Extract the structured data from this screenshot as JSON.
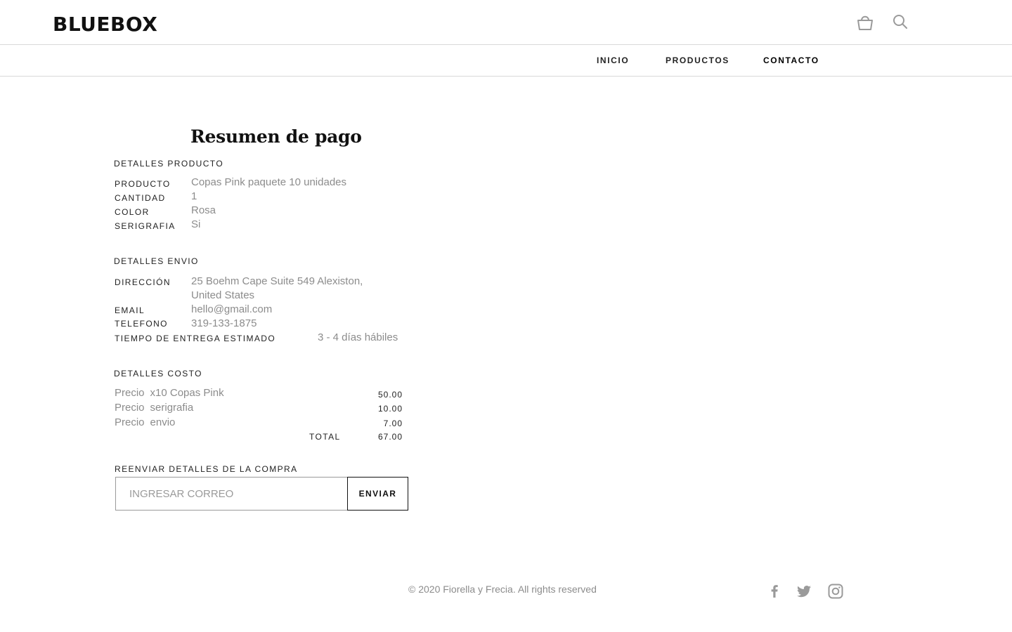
{
  "header": {
    "logo": "BLUEBOX",
    "icons": [
      "shopping-bag-icon",
      "search-icon"
    ]
  },
  "nav": {
    "items": [
      {
        "label": "INICIO"
      },
      {
        "label": "PRODUCTOS"
      },
      {
        "label": "CONTACTO",
        "active": true
      }
    ]
  },
  "summary": {
    "title": "Resumen de pago",
    "product_details": {
      "heading": "DETALLES PRODUCTO",
      "rows": [
        {
          "label": "PRODUCTO",
          "value": "Copas Pink paquete 10 unidades"
        },
        {
          "label": "CANTIDAD",
          "value": "1"
        },
        {
          "label": "COLOR",
          "value": "Rosa"
        },
        {
          "label": "SERIGRAFIA",
          "value": "Si"
        }
      ]
    },
    "shipping_details": {
      "heading": "DETALLES ENVIO",
      "address_label": "DIRECCIÓN",
      "address_line1": "25 Boehm Cape Suite 549  Alexiston,",
      "address_line2": "United States",
      "email_label": "EMAIL",
      "email_value": "hello@gmail.com",
      "phone_label": "TELEFONO",
      "phone_value": "319-133-1875",
      "delivery_label": "TIEMPO DE ENTREGA ESTIMADO",
      "delivery_value": "3 - 4 días hábiles"
    },
    "cost_details": {
      "heading": "DETALLES COSTO",
      "rows": [
        {
          "prefix": "Precio",
          "item": "x10 Copas Pink",
          "amount": "50.00"
        },
        {
          "prefix": "Precio",
          "item": "serigrafia",
          "amount": "10.00"
        },
        {
          "prefix": "Precio",
          "item": "envio",
          "amount": "7.00"
        }
      ],
      "total_label": "TOTAL",
      "total_amount": "67.00"
    },
    "resend": {
      "heading": "REENVIAR DETALLES DE LA COMPRA",
      "placeholder": "INGRESAR CORREO",
      "value": "",
      "button": "ENVIAR"
    }
  },
  "footer": {
    "copyright": "© 2020 Fiorella y Frecia. All rights reserved",
    "social": [
      "facebook-icon",
      "twitter-icon",
      "instagram-icon"
    ]
  },
  "colors": {
    "text_dark": "#222222",
    "text_muted": "#8c8c8c",
    "border": "#d9d9d9",
    "icon_gray": "#9a9a9a"
  }
}
